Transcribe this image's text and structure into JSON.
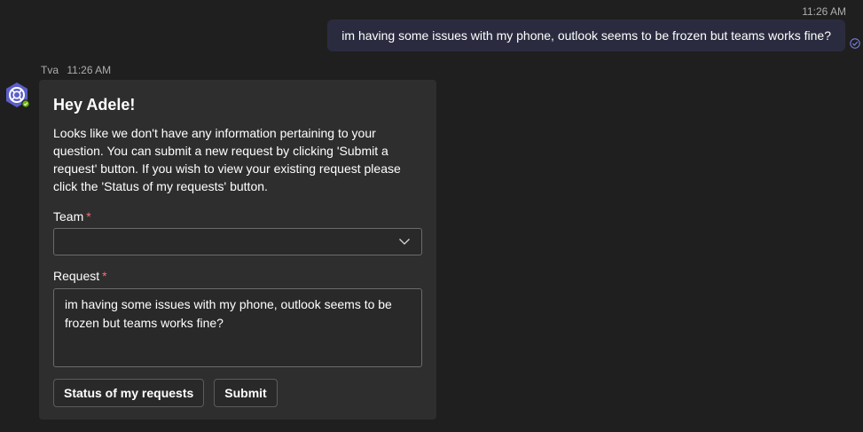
{
  "outgoing": {
    "time": "11:26 AM",
    "text": "im having some issues with my phone, outlook seems to be frozen but teams works fine?",
    "receipt_icon": "read-check-icon"
  },
  "bot": {
    "name": "Tva",
    "time": "11:26 AM",
    "avatar_icon": "lifebuoy-icon",
    "presence_color": "#6bb700",
    "avatar_color": "#5b5fc7"
  },
  "card": {
    "title": "Hey Adele!",
    "body": "Looks like we don't have any information pertaining to your question. You can submit a new request by clicking 'Submit a request' button. If you wish to view your existing request please click the 'Status of my requests' button.",
    "team": {
      "label": "Team",
      "required_mark": "*",
      "value": ""
    },
    "request": {
      "label": "Request",
      "required_mark": "*",
      "line1": "im having some issues with my phone, outlook seems to be",
      "line2": "frozen but teams works fine?"
    },
    "buttons": {
      "status": "Status of my requests",
      "submit": "Submit"
    }
  }
}
